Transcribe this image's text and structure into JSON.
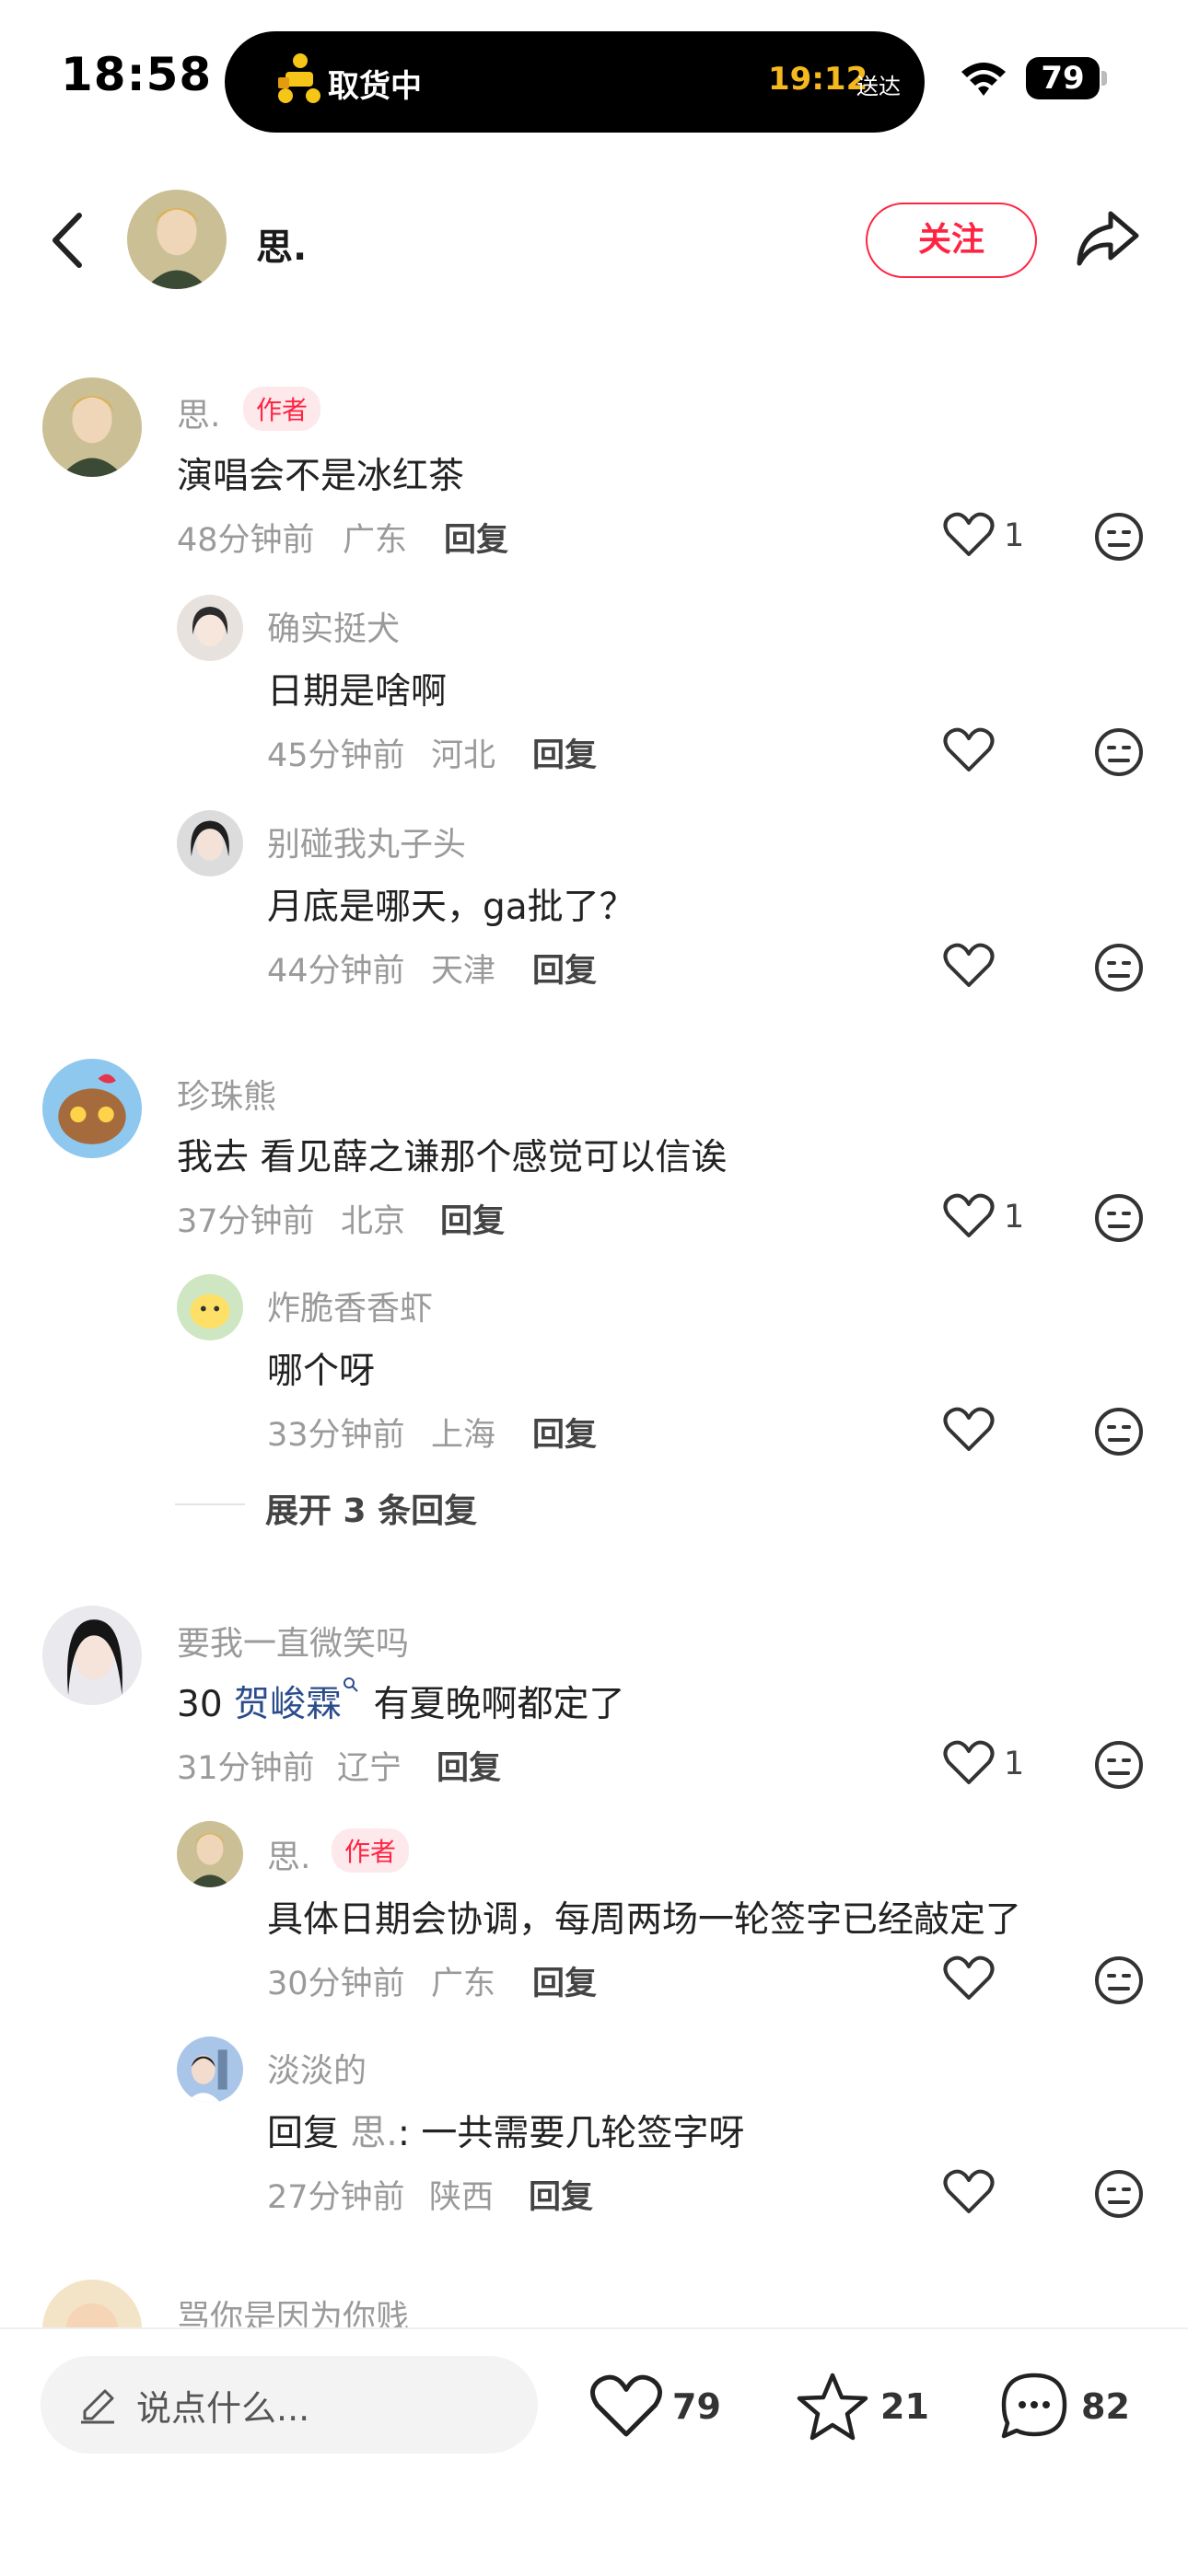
{
  "status": {
    "time": "18:58",
    "island_label": "取货中",
    "island_time": "19:12",
    "island_suffix": "送达",
    "battery": "79"
  },
  "header": {
    "author_name": "思.",
    "follow_label": "关注"
  },
  "author_badge": "作者",
  "reply_label": "回复",
  "comments": [
    {
      "name": "思.",
      "text": "演唱会不是冰红茶",
      "time": "48分钟前",
      "loc": "广东",
      "likes": "1"
    },
    {
      "name": "确实挺犬",
      "text": "日期是啥啊",
      "time": "45分钟前",
      "loc": "河北",
      "likes": ""
    },
    {
      "name": "别碰我丸子头",
      "text": "月底是哪天，ga批了？",
      "time": "44分钟前",
      "loc": "天津",
      "likes": ""
    },
    {
      "name": "珍珠熊",
      "text": "我去 看见薛之谦那个感觉可以信诶",
      "time": "37分钟前",
      "loc": "北京",
      "likes": "1"
    },
    {
      "name": "炸脆香香虾",
      "text": "哪个呀",
      "time": "33分钟前",
      "loc": "上海",
      "likes": ""
    },
    {
      "name": "要我一直微笑吗",
      "text_prefix": "30 ",
      "mention": "贺峻霖",
      "text_suffix": " 有夏晚啊都定了",
      "time": "31分钟前",
      "loc": "辽宁",
      "likes": "1"
    },
    {
      "name": "思.",
      "text": "具体日期会协调，每周两场一轮签字已经敲定了",
      "time": "30分钟前",
      "loc": "广东",
      "likes": ""
    },
    {
      "name": "淡淡的",
      "reply_prefix": "回复 ",
      "reply_to": "思.",
      "text": ": 一共需要几轮签字呀",
      "time": "27分钟前",
      "loc": "陕西",
      "likes": ""
    },
    {
      "name": "骂你是因为你贱"
    }
  ],
  "expand_label": "展开 3 条回复",
  "bottom": {
    "placeholder": "说点什么...",
    "likes": "79",
    "stars": "21",
    "comments": "82"
  },
  "colors": {
    "accent": "#ff2442",
    "mention": "#2b4c8c",
    "island_time": "#f5b81e"
  },
  "icons": [
    "back-icon",
    "share-icon",
    "heart-icon",
    "face-icon",
    "star-icon",
    "chat-icon",
    "pencil-icon",
    "wifi-icon",
    "battery-icon",
    "scooter-icon"
  ]
}
